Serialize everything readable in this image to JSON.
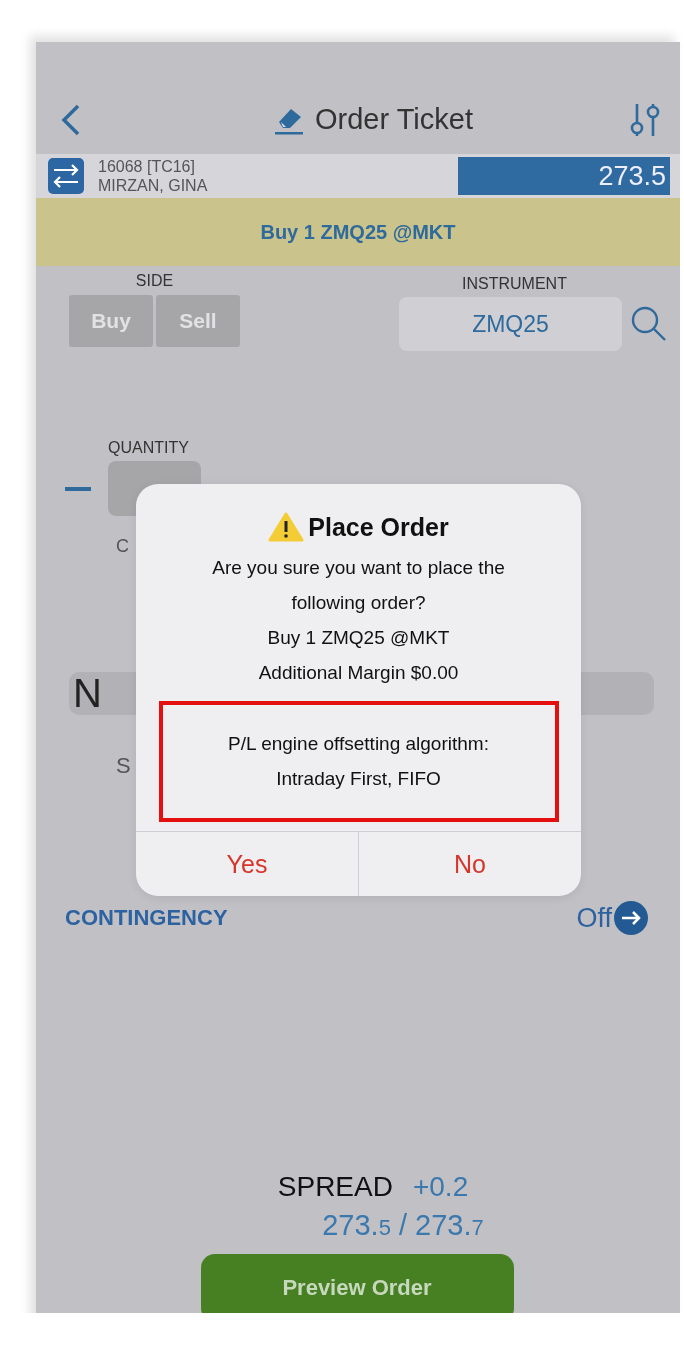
{
  "header": {
    "title": "Order Ticket"
  },
  "account": {
    "id": "16068 [TC16]",
    "name": "MIRZAN, GINA",
    "price": "273.5"
  },
  "banner": "Buy 1 ZMQ25 @MKT",
  "side": {
    "label": "SIDE",
    "options": [
      {
        "label": "Buy",
        "selected": false
      },
      {
        "label": "Sell",
        "selected": false
      }
    ]
  },
  "instrument": {
    "label": "INSTRUMENT",
    "value": "ZMQ25"
  },
  "quantity": {
    "label": "QUANTITY"
  },
  "obscured_fields": [
    {
      "kind": "label",
      "text": "C"
    },
    {
      "kind": "bar",
      "text": "N"
    },
    {
      "kind": "label",
      "text": "S"
    }
  ],
  "contingency": {
    "label": "CONTINGENCY",
    "value": "Off"
  },
  "spread": {
    "label": "SPREAD",
    "value": "+0.2",
    "prices": [
      "273.5",
      "273.7"
    ],
    "separator": "/"
  },
  "preview_button": "Preview Order",
  "dialog": {
    "title": "Place Order",
    "lines": [
      "Are you sure you want to place the following order?",
      "Buy 1 ZMQ25 @MKT",
      "Additional Margin $0.00"
    ],
    "highlight_lines": [
      "P/L engine offsetting algorithm:",
      "Intraday First, FIFO"
    ],
    "buttons": [
      "Yes",
      "No"
    ]
  }
}
